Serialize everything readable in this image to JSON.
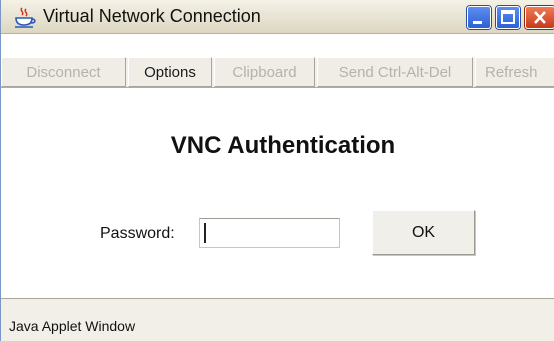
{
  "window": {
    "title": "Virtual Network Connection",
    "icon": "java-cup-icon"
  },
  "toolbar": {
    "buttons": [
      {
        "label": "Disconnect",
        "enabled": false
      },
      {
        "label": "Options",
        "enabled": true
      },
      {
        "label": "Clipboard",
        "enabled": false
      },
      {
        "label": "Send Ctrl-Alt-Del",
        "enabled": false
      },
      {
        "label": "Refresh",
        "enabled": false
      }
    ]
  },
  "auth": {
    "heading": "VNC Authentication",
    "password_label": "Password:",
    "password_value": "",
    "ok_label": "OK"
  },
  "status": {
    "text": "Java Applet Window"
  },
  "colors": {
    "titlebar": "#e8e4d4",
    "window_button_blue": "#2c5fd6",
    "close_button_red": "#c8391a",
    "disabled_text": "#b5b2aa"
  }
}
